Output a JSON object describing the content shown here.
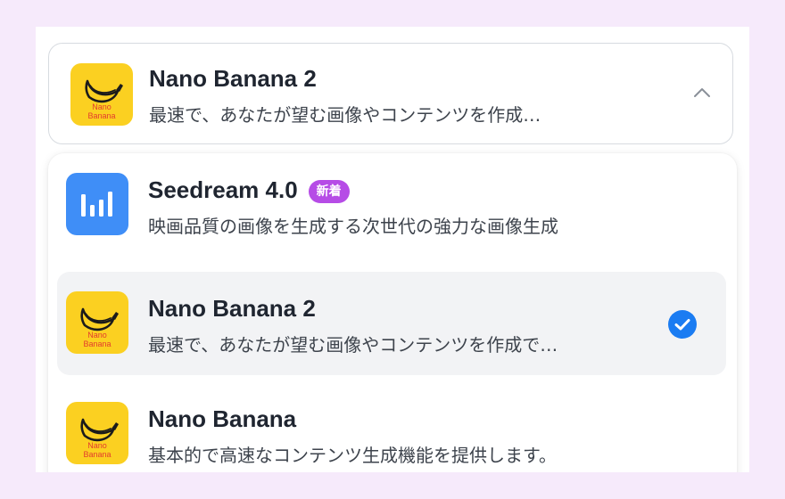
{
  "selected": {
    "title": "Nano Banana 2",
    "description": "最速で、あなたが望む画像やコンテンツを作成…",
    "icon": "banana-logo-icon",
    "chevron": "chevron-up-icon"
  },
  "options": [
    {
      "title": "Seedream 4.0",
      "badge": "新着",
      "description": "映画品質の画像を生成する次世代の強力な画像生成",
      "icon": "seedream-logo-icon"
    },
    {
      "title": "Nano Banana 2",
      "description": "最速で、あなたが望む画像やコンテンツを作成で…",
      "icon": "banana-logo-icon",
      "selected": true
    },
    {
      "title": "Nano Banana",
      "description": "基本的で高速なコンテンツ生成機能を提供します。",
      "icon": "banana-logo-icon"
    }
  ],
  "logo_text": {
    "line1": "Nano",
    "line2": "Banana"
  },
  "colors": {
    "page_background": "#f6eafb",
    "banana_logo": "#fbd021",
    "seedream_logo": "#3f8ef7",
    "badge": "#b64ce6",
    "check": "#1b7cf2",
    "selected_row": "#f2f3f5"
  }
}
